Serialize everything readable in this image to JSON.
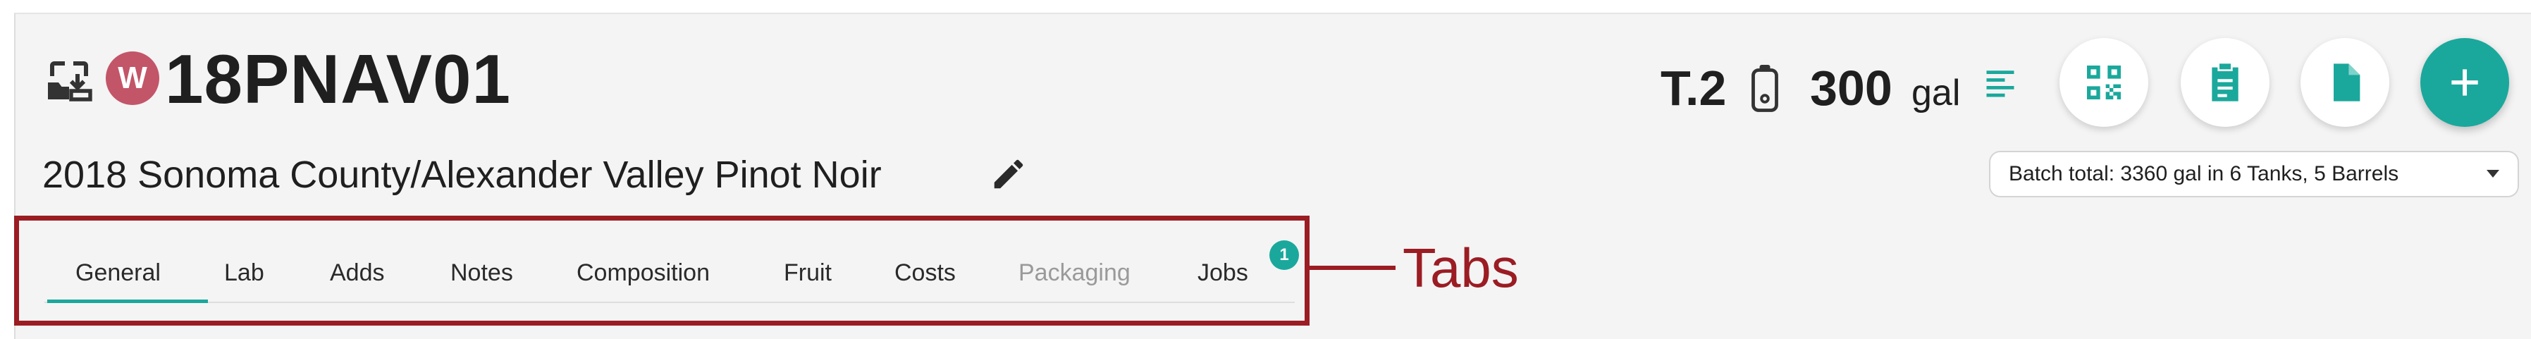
{
  "header": {
    "avatar_letter": "W",
    "batch_code": "18PNAV01",
    "batch_name": "2018 Sonoma County/Alexander Valley Pinot Noir",
    "vessel": "T.2",
    "volume": "300",
    "volume_unit": "gal",
    "batch_total": "Batch total: 3360 gal in 6 Tanks, 5 Barrels"
  },
  "icons": {
    "transfer": "transfer-icon",
    "edit": "pencil-icon",
    "tank": "tank-icon",
    "details": "text-lines-icon",
    "qr": "qr-code-icon",
    "clipboard": "clipboard-icon",
    "document": "document-icon",
    "add": "plus-icon",
    "dropdown": "caret-down-icon"
  },
  "tabs": [
    {
      "label": "General",
      "active": true
    },
    {
      "label": "Lab"
    },
    {
      "label": "Adds"
    },
    {
      "label": "Notes"
    },
    {
      "label": "Composition"
    },
    {
      "label": "Fruit"
    },
    {
      "label": "Costs"
    },
    {
      "label": "Packaging",
      "disabled": true
    },
    {
      "label": "Jobs",
      "badge": "1"
    }
  ],
  "annotation": {
    "label": "Tabs"
  },
  "colors": {
    "accent": "#1aa89c",
    "avatar": "#c35568",
    "annotation": "#9b1c23",
    "background": "#f4f4f4",
    "text": "#1f1f1f",
    "disabled_text": "#9a9a9a"
  }
}
